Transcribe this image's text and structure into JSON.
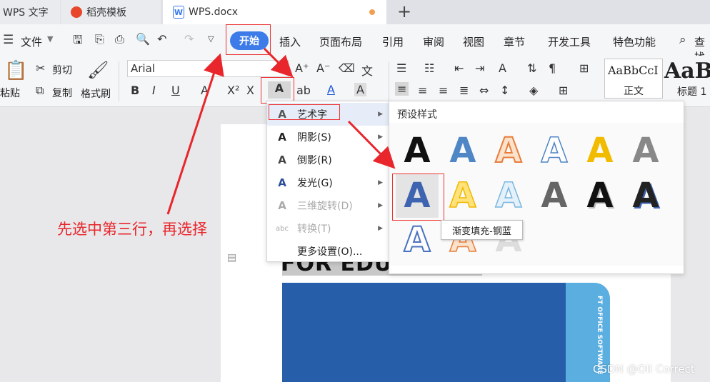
{
  "tabs": {
    "app": "WPS 文字",
    "template": "稻壳模板",
    "document": "WPS.docx",
    "new_tab": "+"
  },
  "menu": {
    "file": "文件",
    "start": "开始",
    "insert": "插入",
    "layout": "页面布局",
    "reference": "引用",
    "review": "审阅",
    "view": "视图",
    "chapter": "章节",
    "dev": "开发工具",
    "special": "特色功能",
    "search": "查找"
  },
  "ribbon": {
    "paste": "粘贴",
    "cut": "剪切",
    "copy": "复制",
    "format_painter": "格式刷",
    "font_name": "Arial",
    "style_normal_preview": "AaBbCcI",
    "style_normal": "正文",
    "style_h1_preview": "AaB",
    "style_h1": "标题 1"
  },
  "dropdown": {
    "items": [
      {
        "label": "艺术字",
        "glyph": "A",
        "has_submenu": true,
        "enabled": true,
        "active": true
      },
      {
        "label": "阴影(S)",
        "glyph": "A",
        "has_submenu": true,
        "enabled": true
      },
      {
        "label": "倒影(R)",
        "glyph": "A",
        "has_submenu": true,
        "enabled": true
      },
      {
        "label": "发光(G)",
        "glyph": "A",
        "has_submenu": true,
        "enabled": true
      },
      {
        "label": "三维旋转(D)",
        "glyph": "A",
        "has_submenu": true,
        "enabled": false
      },
      {
        "label": "转换(T)",
        "glyph": "abc",
        "has_submenu": true,
        "enabled": false
      },
      {
        "label": "更多设置(O)...",
        "glyph": "",
        "has_submenu": false,
        "enabled": true
      }
    ]
  },
  "preset": {
    "title": "预设样式",
    "tooltip": "渐变填充-钢蓝",
    "letter": "A"
  },
  "document": {
    "heading_partial": "FOR EDU",
    "side_text": "FT OFFICE SOFTWARE"
  },
  "annotation": "先选中第三行，再选择",
  "watermark": "CSDN @OII Correct",
  "colors": {
    "accent": "#3c7be8",
    "annotation_red": "#e8262b",
    "doc_blue": "#275eaa",
    "doc_cyan": "#5aaee0"
  }
}
